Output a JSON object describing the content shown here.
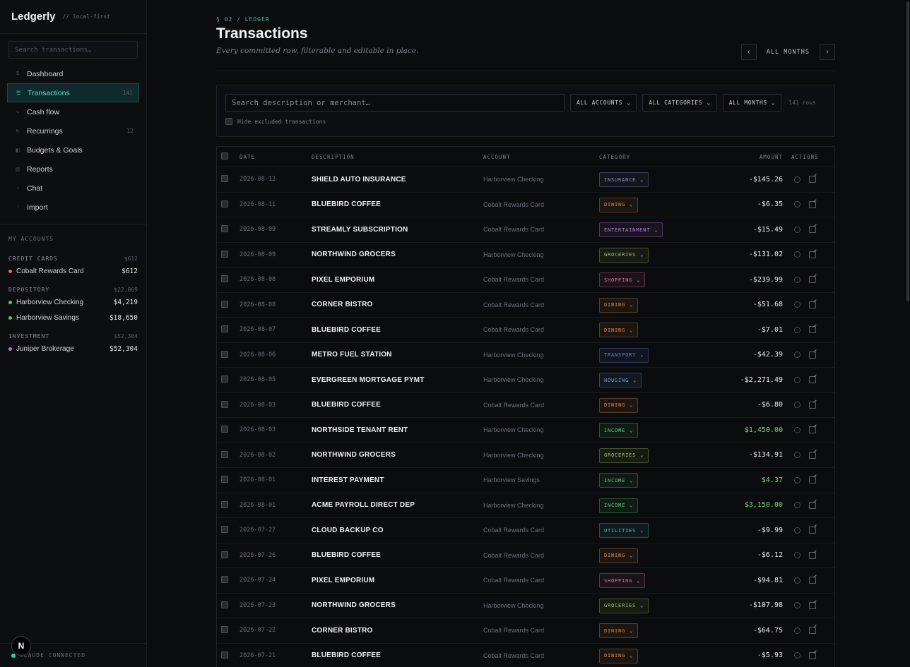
{
  "brand": {
    "name": "Ledgerly",
    "tag": "// local-first"
  },
  "sidebar": {
    "search_placeholder": "Search transactions…",
    "nav": [
      {
        "icon": "dollar-icon",
        "glyph": "$",
        "label": "Dashboard",
        "count": ""
      },
      {
        "icon": "list-icon",
        "glyph": "☰",
        "label": "Transactions",
        "count": "141",
        "active": true
      },
      {
        "icon": "trend-icon",
        "glyph": "⌁",
        "label": "Cash flow",
        "count": ""
      },
      {
        "icon": "repeat-icon",
        "glyph": "↻",
        "label": "Recurrings",
        "count": "12"
      },
      {
        "icon": "budget-icon",
        "glyph": "◧",
        "label": "Budgets & Goals",
        "count": ""
      },
      {
        "icon": "report-icon",
        "glyph": "▥",
        "label": "Reports",
        "count": ""
      },
      {
        "icon": "chat-icon",
        "glyph": "›",
        "label": "Chat",
        "count": ""
      },
      {
        "icon": "import-icon",
        "glyph": "↑",
        "label": "Import",
        "count": ""
      }
    ],
    "accounts_title": "MY ACCOUNTS",
    "groups": [
      {
        "name": "CREDIT CARDS",
        "total": "$612",
        "accounts": [
          {
            "name": "Cobalt Rewards Card",
            "amount": "$612",
            "color": "#e86a6a"
          }
        ]
      },
      {
        "name": "DEPOSITORY",
        "total": "$22,869",
        "accounts": [
          {
            "name": "Harborview Checking",
            "amount": "$4,219",
            "color": "#4fc77a"
          },
          {
            "name": "Harborview Savings",
            "amount": "$18,650",
            "color": "#4fc77a"
          }
        ]
      },
      {
        "name": "INVESTMENT",
        "total": "$52,304",
        "accounts": [
          {
            "name": "Juniper Brokerage",
            "amount": "$52,304",
            "color": "#b07be8"
          }
        ]
      }
    ],
    "footer_status": "CLAUDE CONNECTED",
    "badge": "N"
  },
  "header": {
    "eyebrow": "§ 02 / LEDGER",
    "title": "Transactions",
    "subtitle": "Every committed row, filterable and editable in place.",
    "month_label": "ALL MONTHS",
    "prev": "‹",
    "next": "›"
  },
  "filters": {
    "search_placeholder": "Search description or merchant…",
    "accounts": "ALL ACCOUNTS",
    "categories": "ALL CATEGORIES",
    "months": "ALL MONTHS",
    "row_count": "141 rows",
    "hide_excluded": "Hide excluded transactions"
  },
  "table": {
    "columns": [
      "DATE",
      "DESCRIPTION",
      "ACCOUNT",
      "CATEGORY",
      "AMOUNT",
      "ACTIONS"
    ],
    "rows": [
      {
        "date": "2026-08-12",
        "desc": "SHIELD AUTO INSURANCE",
        "account": "Harborview Checking",
        "category": "INSURANCE",
        "amount": "-$145.26"
      },
      {
        "date": "2026-08-11",
        "desc": "BLUEBIRD COFFEE",
        "account": "Cobalt Rewards Card",
        "category": "DINING",
        "amount": "-$6.35"
      },
      {
        "date": "2026-08-09",
        "desc": "STREAMLY SUBSCRIPTION",
        "account": "Cobalt Rewards Card",
        "category": "ENTERTAINMENT",
        "amount": "-$15.49"
      },
      {
        "date": "2026-08-09",
        "desc": "NORTHWIND GROCERS",
        "account": "Harborview Checking",
        "category": "GROCERIES",
        "amount": "-$131.02"
      },
      {
        "date": "2026-08-08",
        "desc": "PIXEL EMPORIUM",
        "account": "Cobalt Rewards Card",
        "category": "SHOPPING",
        "amount": "-$239.99"
      },
      {
        "date": "2026-08-08",
        "desc": "CORNER BISTRO",
        "account": "Cobalt Rewards Card",
        "category": "DINING",
        "amount": "-$51.68"
      },
      {
        "date": "2026-08-07",
        "desc": "BLUEBIRD COFFEE",
        "account": "Cobalt Rewards Card",
        "category": "DINING",
        "amount": "-$7.01"
      },
      {
        "date": "2026-08-06",
        "desc": "METRO FUEL STATION",
        "account": "Harborview Checking",
        "category": "TRANSPORT",
        "amount": "-$42.39"
      },
      {
        "date": "2026-08-05",
        "desc": "EVERGREEN MORTGAGE PYMT",
        "account": "Harborview Checking",
        "category": "HOUSING",
        "amount": "-$2,271.49"
      },
      {
        "date": "2026-08-03",
        "desc": "BLUEBIRD COFFEE",
        "account": "Cobalt Rewards Card",
        "category": "DINING",
        "amount": "-$6.80"
      },
      {
        "date": "2026-08-03",
        "desc": "NORTHSIDE TENANT RENT",
        "account": "Harborview Checking",
        "category": "INCOME",
        "amount": "$1,450.00",
        "positive": true
      },
      {
        "date": "2026-08-02",
        "desc": "NORTHWIND GROCERS",
        "account": "Harborview Checking",
        "category": "GROCERIES",
        "amount": "-$134.91"
      },
      {
        "date": "2026-08-01",
        "desc": "INTEREST PAYMENT",
        "account": "Harborview Savings",
        "category": "INCOME",
        "amount": "$4.37",
        "positive": true
      },
      {
        "date": "2026-08-01",
        "desc": "ACME PAYROLL DIRECT DEP",
        "account": "Harborview Checking",
        "category": "INCOME",
        "amount": "$3,150.00",
        "positive": true
      },
      {
        "date": "2026-07-27",
        "desc": "CLOUD BACKUP CO",
        "account": "Cobalt Rewards Card",
        "category": "UTILITIES",
        "amount": "-$9.99"
      },
      {
        "date": "2026-07-26",
        "desc": "BLUEBIRD COFFEE",
        "account": "Cobalt Rewards Card",
        "category": "DINING",
        "amount": "-$6.12"
      },
      {
        "date": "2026-07-24",
        "desc": "PIXEL EMPORIUM",
        "account": "Cobalt Rewards Card",
        "category": "SHOPPING",
        "amount": "-$94.81"
      },
      {
        "date": "2026-07-23",
        "desc": "NORTHWIND GROCERS",
        "account": "Harborview Checking",
        "category": "GROCERIES",
        "amount": "-$107.98"
      },
      {
        "date": "2026-07-22",
        "desc": "CORNER BISTRO",
        "account": "Cobalt Rewards Card",
        "category": "DINING",
        "amount": "-$64.75"
      },
      {
        "date": "2026-07-21",
        "desc": "BLUEBIRD COFFEE",
        "account": "Cobalt Rewards Card",
        "category": "DINING",
        "amount": "-$5.93"
      }
    ]
  },
  "category_colors": {
    "INSURANCE": "#8b8fc9",
    "DINING": "#e08a4a",
    "ENTERTAINMENT": "#c07be0",
    "GROCERIES": "#a8c65a",
    "SHOPPING": "#e06a9a",
    "TRANSPORT": "#6a7ae8",
    "HOUSING": "#5aa8e0",
    "INCOME": "#5ac87a",
    "UTILITIES": "#4ac0c8"
  }
}
